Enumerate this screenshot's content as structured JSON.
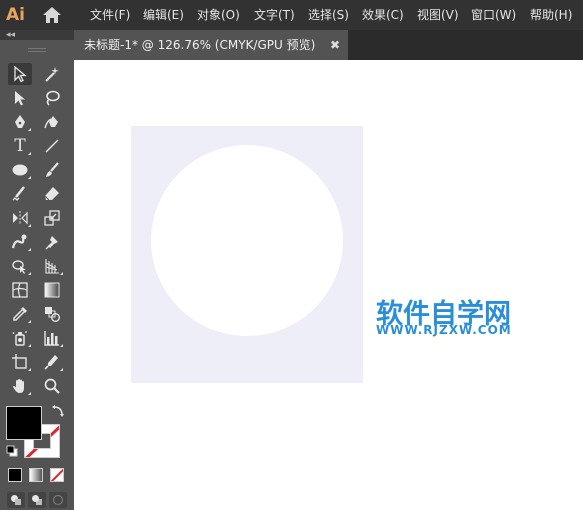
{
  "app": {
    "logo": "Ai"
  },
  "menu": {
    "items": [
      {
        "label": "文件(F)"
      },
      {
        "label": "编辑(E)"
      },
      {
        "label": "对象(O)"
      },
      {
        "label": "文字(T)"
      },
      {
        "label": "选择(S)"
      },
      {
        "label": "效果(C)"
      },
      {
        "label": "视图(V)"
      },
      {
        "label": "窗口(W)"
      },
      {
        "label": "帮助(H)"
      }
    ]
  },
  "panel": {
    "collapse_label": "◂◂"
  },
  "document_tab": {
    "title": "未标题-1* @ 126.76% (CMYK/GPU 预览)",
    "close_label": "✖"
  },
  "tools": [
    {
      "name": "selection-tool-icon"
    },
    {
      "name": "magic-wand-tool-icon"
    },
    {
      "name": "direct-selection-tool-icon"
    },
    {
      "name": "lasso-tool-icon"
    },
    {
      "name": "pen-tool-icon"
    },
    {
      "name": "curvature-tool-icon"
    },
    {
      "name": "type-tool-icon",
      "label": "T"
    },
    {
      "name": "line-segment-tool-icon"
    },
    {
      "name": "ellipse-tool-icon"
    },
    {
      "name": "paintbrush-tool-icon"
    },
    {
      "name": "shaper-tool-icon"
    },
    {
      "name": "eraser-tool-icon"
    },
    {
      "name": "reflect-tool-icon"
    },
    {
      "name": "scale-tool-icon"
    },
    {
      "name": "warp-tool-icon"
    },
    {
      "name": "puppet-warp-tool-icon"
    },
    {
      "name": "shape-builder-tool-icon"
    },
    {
      "name": "perspective-grid-tool-icon"
    },
    {
      "name": "mesh-tool-icon"
    },
    {
      "name": "gradient-tool-icon"
    },
    {
      "name": "eyedropper-tool-icon"
    },
    {
      "name": "blend-tool-icon"
    },
    {
      "name": "symbol-sprayer-tool-icon"
    },
    {
      "name": "column-graph-tool-icon"
    },
    {
      "name": "artboard-tool-icon"
    },
    {
      "name": "slice-tool-icon"
    },
    {
      "name": "hand-tool-icon"
    },
    {
      "name": "zoom-tool-icon"
    }
  ],
  "colors": {
    "fill": "#000000",
    "stroke": "none",
    "artboard_rect": "#eeeef8",
    "circle": "#ffffff",
    "watermark": "#2a8fd6"
  },
  "watermark": {
    "title": "软件自学网",
    "url": "WWW.RJZXW.COM"
  }
}
